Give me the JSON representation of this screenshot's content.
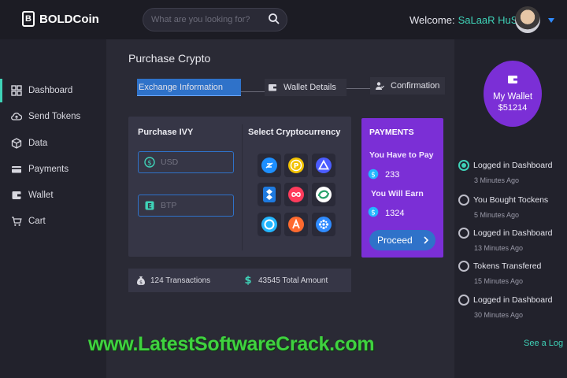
{
  "app": {
    "logo_mark": "B",
    "logo_text": "BOLDCoin"
  },
  "search": {
    "placeholder": "What are you looking for?"
  },
  "user": {
    "welcome_label": "Welcome:",
    "name": "SaLaaR HuSyN"
  },
  "sidebar": {
    "items": [
      {
        "label": "Dashboard",
        "icon": "dashboard-grid-icon",
        "active": true
      },
      {
        "label": "Send Tokens",
        "icon": "cloud-upload-icon"
      },
      {
        "label": "Data",
        "icon": "cube-icon"
      },
      {
        "label": "Payments",
        "icon": "credit-card-icon"
      },
      {
        "label": "Wallet",
        "icon": "wallet-icon"
      },
      {
        "label": "Cart",
        "icon": "cart-icon"
      }
    ]
  },
  "page": {
    "title": "Purchase Crypto"
  },
  "steps": [
    {
      "label": "Exchange Information",
      "active": true
    },
    {
      "label": "Wallet Details",
      "icon": "wallet-icon"
    },
    {
      "label": "Confirmation",
      "icon": "user-check-icon"
    }
  ],
  "purchase": {
    "heading": "Purchase IVY",
    "usd_placeholder": "USD",
    "btp_placeholder": "BTP"
  },
  "crypto": {
    "heading": "Select Cryptocurrency",
    "coins": [
      {
        "icon": "dash-coin-icon",
        "color": "#2f8bff"
      },
      {
        "icon": "p-coin-icon",
        "color": "#f2c200"
      },
      {
        "icon": "triangle-coin-icon",
        "color": "#4b5cff"
      },
      {
        "icon": "bancor-coin-icon",
        "color": "#1e7ae0"
      },
      {
        "icon": "infinity-coin-icon",
        "color": "#ff3b5c"
      },
      {
        "icon": "swirl-coin-icon",
        "color": "#27c08a"
      },
      {
        "icon": "ring-coin-icon",
        "color": "#23b6ff"
      },
      {
        "icon": "a-coin-icon",
        "color": "#ff6a2f"
      },
      {
        "icon": "dots-coin-icon",
        "color": "#2f8bff"
      }
    ]
  },
  "payments": {
    "heading": "PAYMENTS",
    "pay_label": "You Have to Pay",
    "pay_value": "233",
    "earn_label": "You Will Earn",
    "earn_value": "1324",
    "proceed_label": "Proceed"
  },
  "stats": {
    "transactions": "124 Transactions",
    "total_amount": "43545 Total Amount"
  },
  "wallet": {
    "title": "My Wallet",
    "balance": "$51214"
  },
  "activity": [
    {
      "title": "Logged in Dashboard",
      "time": "3 Minutes Ago",
      "checked": true
    },
    {
      "title": "You Bought Tockens",
      "time": "5 Minutes Ago"
    },
    {
      "title": "Logged in Dashboard",
      "time": "13 Minutes Ago"
    },
    {
      "title": "Tokens Transfered",
      "time": "15 Minutes Ago"
    },
    {
      "title": "Logged in Dashboard",
      "time": "30 Minutes Ago"
    }
  ],
  "see_log": "See a Log",
  "watermark": "www.LatestSoftwareCrack.com",
  "colors": {
    "accent_teal": "#3fd3b8",
    "accent_blue": "#2f72c9",
    "accent_purple": "#7b2fd6",
    "watermark_green": "#3fd23f"
  }
}
